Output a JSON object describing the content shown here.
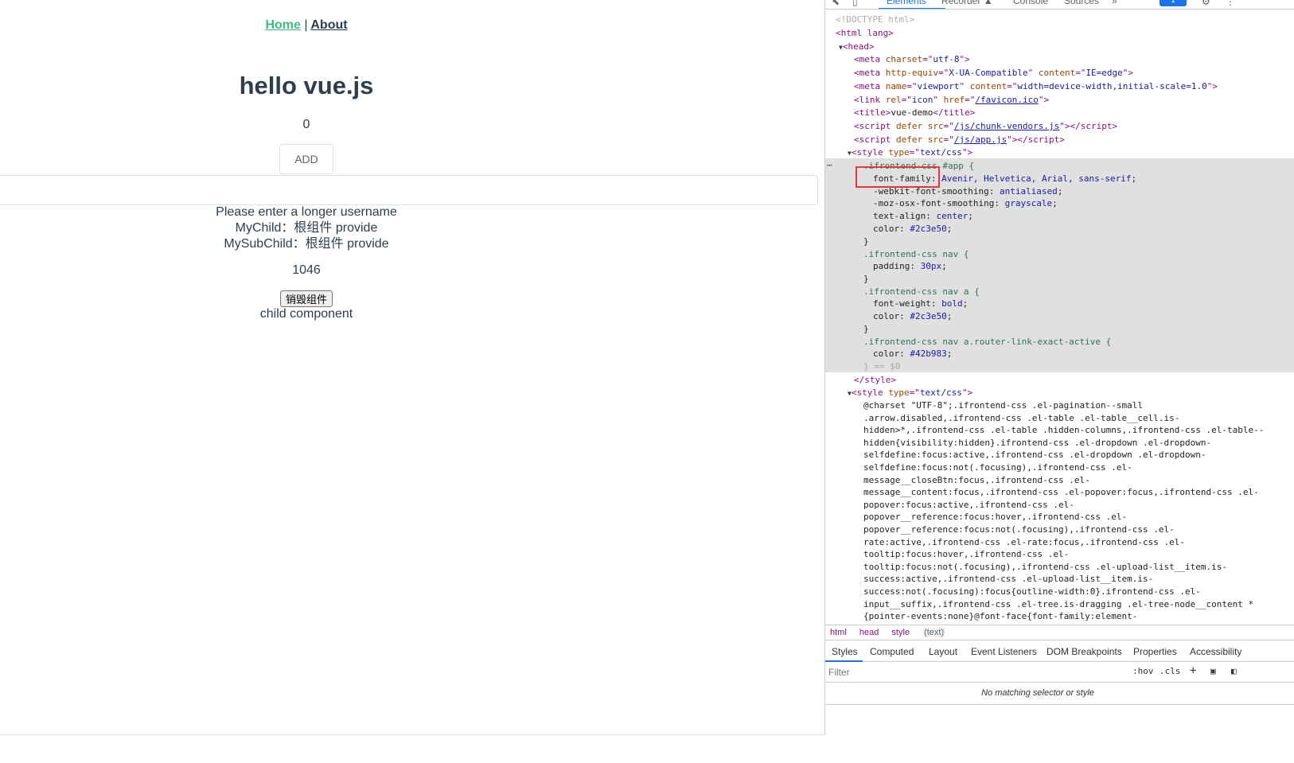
{
  "app": {
    "nav": {
      "home": "Home",
      "separator": "|",
      "about": "About"
    },
    "title": "hello vue.js",
    "counter": "0",
    "add_button": "ADD",
    "username_input_value": "",
    "message": "Please enter a longer username",
    "my_child": "MyChild：根组件 provide",
    "my_sub_child": "MySubChild：根组件 provide",
    "number": "1046",
    "destroy_button": "销毁组件",
    "child_component": "child component"
  },
  "devtools": {
    "tabs": [
      "Elements",
      "Recorder ▲",
      "Console",
      "Sources",
      "»"
    ],
    "badge": "1",
    "breadcrumb": [
      "html",
      "head",
      "style",
      "(text)"
    ],
    "styles_tabs": [
      "Styles",
      "Computed",
      "Layout",
      "Event Listeners",
      "DOM Breakpoints",
      "Properties",
      "Accessibility"
    ],
    "filter_placeholder": "Filter",
    "filter_buttons": [
      ":hov",
      ".cls",
      "+"
    ],
    "no_match": "No matching selector or style",
    "colors": {
      "accent": "#1a73e8",
      "highlight": "#e53935",
      "vue_green": "#42b983",
      "text": "#2c3e50"
    },
    "dom": {
      "doctype": "<!DOCTYPE html>",
      "html_open": "<html lang>",
      "head_open": "<head>",
      "meta_charset": {
        "tag": "meta",
        "attrs": [
          [
            "charset",
            "utf-8"
          ]
        ]
      },
      "meta_compat": {
        "tag": "meta",
        "attrs": [
          [
            "http-equiv",
            "X-UA-Compatible"
          ],
          [
            "content",
            "IE=edge"
          ]
        ]
      },
      "meta_viewport": {
        "tag": "meta",
        "attrs": [
          [
            "name",
            "viewport"
          ],
          [
            "content",
            "width=device-width,initial-scale=1.0"
          ]
        ]
      },
      "link_icon": {
        "tag": "link",
        "attrs": [
          [
            "rel",
            "icon"
          ],
          [
            "href",
            "/favicon.ico"
          ]
        ]
      },
      "title": "vue-demo",
      "script1": "/js/chunk-vendors.js",
      "script2": "/js/app.js",
      "style_type": "text/css",
      "css_rule1_selector": ".ifrontend-css",
      "css_rule1_rest": " #app {",
      "css_rule1_props": [
        [
          "font-family",
          "Avenir, Helvetica, Arial, sans-serif"
        ],
        [
          "-webkit-font-smoothing",
          "antialiased"
        ],
        [
          "-moz-osx-font-smoothing",
          "grayscale"
        ],
        [
          "text-align",
          "center"
        ],
        [
          "color",
          "#2c3e50"
        ]
      ],
      "css_rule2_selector": ".ifrontend-css nav {",
      "css_rule2_props": [
        [
          "padding",
          "30px"
        ]
      ],
      "css_rule3_selector": ".ifrontend-css nav a {",
      "css_rule3_props": [
        [
          "font-weight",
          "bold"
        ],
        [
          "color",
          "#2c3e50"
        ]
      ],
      "css_rule4_selector": ".ifrontend-css nav a.router-link-exact-active {",
      "css_rule4_props": [
        [
          "color",
          "#42b983"
        ]
      ],
      "close_brace_eq": "} == $0",
      "style_close": "</style>",
      "style2_type": "text/css",
      "minified_css_lines": [
        "@charset \"UTF-8\";.ifrontend-css .el-pagination--small",
        ".arrow.disabled,.ifrontend-css .el-table .el-table__cell.is-",
        "hidden>*,.ifrontend-css .el-table .hidden-columns,.ifrontend-css .el-table--",
        "hidden{visibility:hidden}.ifrontend-css .el-dropdown .el-dropdown-",
        "selfdefine:focus:active,.ifrontend-css .el-dropdown .el-dropdown-",
        "selfdefine:focus:not(.focusing),.ifrontend-css .el-",
        "message__closeBtn:focus,.ifrontend-css .el-",
        "message__content:focus,.ifrontend-css .el-popover:focus,.ifrontend-css .el-",
        "popover:focus:active,.ifrontend-css .el-",
        "popover__reference:focus:hover,.ifrontend-css .el-",
        "popover__reference:focus:not(.focusing),.ifrontend-css .el-",
        "rate:active,.ifrontend-css .el-rate:focus,.ifrontend-css .el-",
        "tooltip:focus:hover,.ifrontend-css .el-",
        "tooltip:focus:not(.focusing),.ifrontend-css .el-upload-list__item.is-",
        "success:active,.ifrontend-css .el-upload-list__item.is-",
        "success:not(.focusing):focus{outline-width:0}.ifrontend-css .el-",
        "input__suffix,.ifrontend-css .el-tree.is-dragging .el-tree-node__content *",
        "{pointer-events:none}@font-face{font-family:element-"
      ]
    }
  }
}
